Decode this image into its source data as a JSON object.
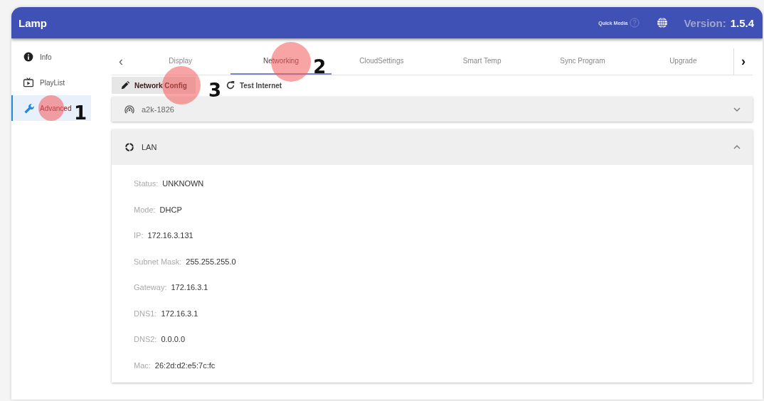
{
  "header": {
    "title": "Lamp",
    "quick_media": "Quick Media",
    "version_label": "Version:",
    "version": "1.5.4"
  },
  "sidebar": {
    "items": [
      {
        "label": "Info",
        "kind": "info",
        "selected": false
      },
      {
        "label": "PlayList",
        "kind": "playlist",
        "selected": false
      },
      {
        "label": "Advanced",
        "kind": "advanced",
        "selected": true,
        "callout": "1"
      }
    ]
  },
  "tabs": {
    "prev": "‹",
    "next": "›",
    "items": [
      {
        "label": "Display",
        "selected": false
      },
      {
        "label": "Networking",
        "selected": true,
        "callout": "2"
      },
      {
        "label": "CloudSettings",
        "selected": false
      },
      {
        "label": "Smart Temp",
        "selected": false
      },
      {
        "label": "Sync Program",
        "selected": false
      },
      {
        "label": "Upgrade",
        "selected": false
      }
    ]
  },
  "toolbar": {
    "buttons": [
      {
        "label": "Network Config",
        "kind": "edit",
        "selected": true,
        "callout": "3"
      },
      {
        "label": "Test Internet",
        "kind": "refresh",
        "selected": false
      }
    ]
  },
  "panels": [
    {
      "title": "a2k-1826",
      "kind": "wifi",
      "expanded": false
    },
    {
      "title": "LAN",
      "kind": "lan",
      "expanded": true,
      "fields": [
        {
          "label": "Status:",
          "value": "UNKNOWN"
        },
        {
          "label": "Mode:",
          "value": "DHCP"
        },
        {
          "label": "IP:",
          "value": "172.16.3.131"
        },
        {
          "label": "Subnet Mask:",
          "value": "255.255.255.0"
        },
        {
          "label": "Gateway:",
          "value": "172.16.3.1"
        },
        {
          "label": "DNS1:",
          "value": "172.16.3.1"
        },
        {
          "label": "DNS2:",
          "value": "0.0.0.0"
        },
        {
          "label": "Mac:",
          "value": "26:2d:d2:e5:7c:fc"
        }
      ]
    }
  ]
}
